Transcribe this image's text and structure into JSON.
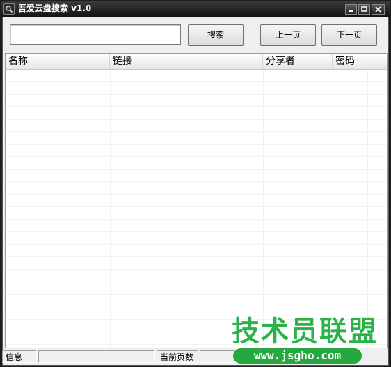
{
  "window": {
    "title": "吾爱云盘搜索 v1.0",
    "icon": "search-icon",
    "controls": [
      "minimize-icon",
      "maximize-icon",
      "close-icon"
    ]
  },
  "toolbar": {
    "search_value": "",
    "search_label": "搜索",
    "prev_label": "上一页",
    "next_label": "下一页"
  },
  "table": {
    "columns": [
      "名称",
      "链接",
      "分享者",
      "密码"
    ],
    "rows": []
  },
  "statusbar": {
    "info": "信息",
    "info_value": "",
    "page_label": "当前页数",
    "page_value": ""
  },
  "watermark": {
    "text": "技术员联盟",
    "url": "www.jsgho.com"
  },
  "colors": {
    "titlebar": "#1b1b1b",
    "window_bg": "#efefef",
    "watermark_green": "#2bb34a"
  }
}
